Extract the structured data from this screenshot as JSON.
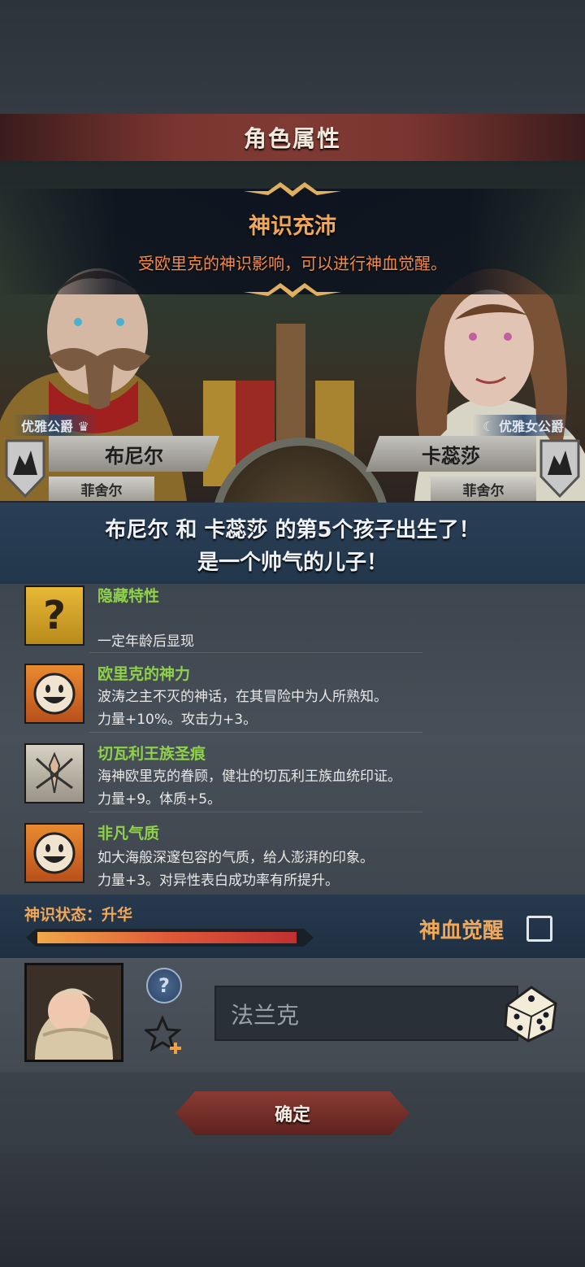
{
  "header": {
    "title": "角色属性"
  },
  "announcement": {
    "headline": "神识充沛",
    "subtext": "受欧里克的神识影响，可以进行神血觉醒。"
  },
  "parents": {
    "father": {
      "title": "优雅公爵",
      "name": "布尼尔",
      "house": "菲舍尔"
    },
    "mother": {
      "title": "优雅女公爵",
      "name": "卡蕊莎",
      "house": "菲舍尔"
    }
  },
  "birth_message": {
    "line1": "布尼尔 和 卡蕊莎 的第5个孩子出生了！",
    "line2": "是一个帅气的儿子！"
  },
  "traits": [
    {
      "name": "隐藏特性",
      "desc1": "",
      "desc2": "一定年龄后显现",
      "icon": "question-mark-icon"
    },
    {
      "name": "欧里克的神力",
      "desc1": "波涛之主不灭的神话，在其冒险中为人所熟知。",
      "desc2": "力量+10%。攻击力+3。",
      "icon": "smiley-face-icon"
    },
    {
      "name": "切瓦利王族圣痕",
      "desc1": "海神欧里克的眷顾，健壮的切瓦利王族血统印证。",
      "desc2": "力量+9。体质+5。",
      "icon": "royal-crest-icon"
    },
    {
      "name": "非凡气质",
      "desc1": "如大海般深邃包容的气质，给人澎湃的印象。",
      "desc2": "力量+3。对异性表白成功率有所提升。",
      "icon": "smiley-face-icon"
    }
  ],
  "divine_state": {
    "label": "神识状态：",
    "value": "升华",
    "progress": 0.98,
    "awaken_label": "神血觉醒",
    "awaken_checked": false
  },
  "child": {
    "name_value": "法兰克",
    "help_label": "?"
  },
  "confirm_label": "确定",
  "colors": {
    "accent_orange": "#f0a858",
    "trait_green": "#8fd14a",
    "title_red": "#7f3a33"
  }
}
